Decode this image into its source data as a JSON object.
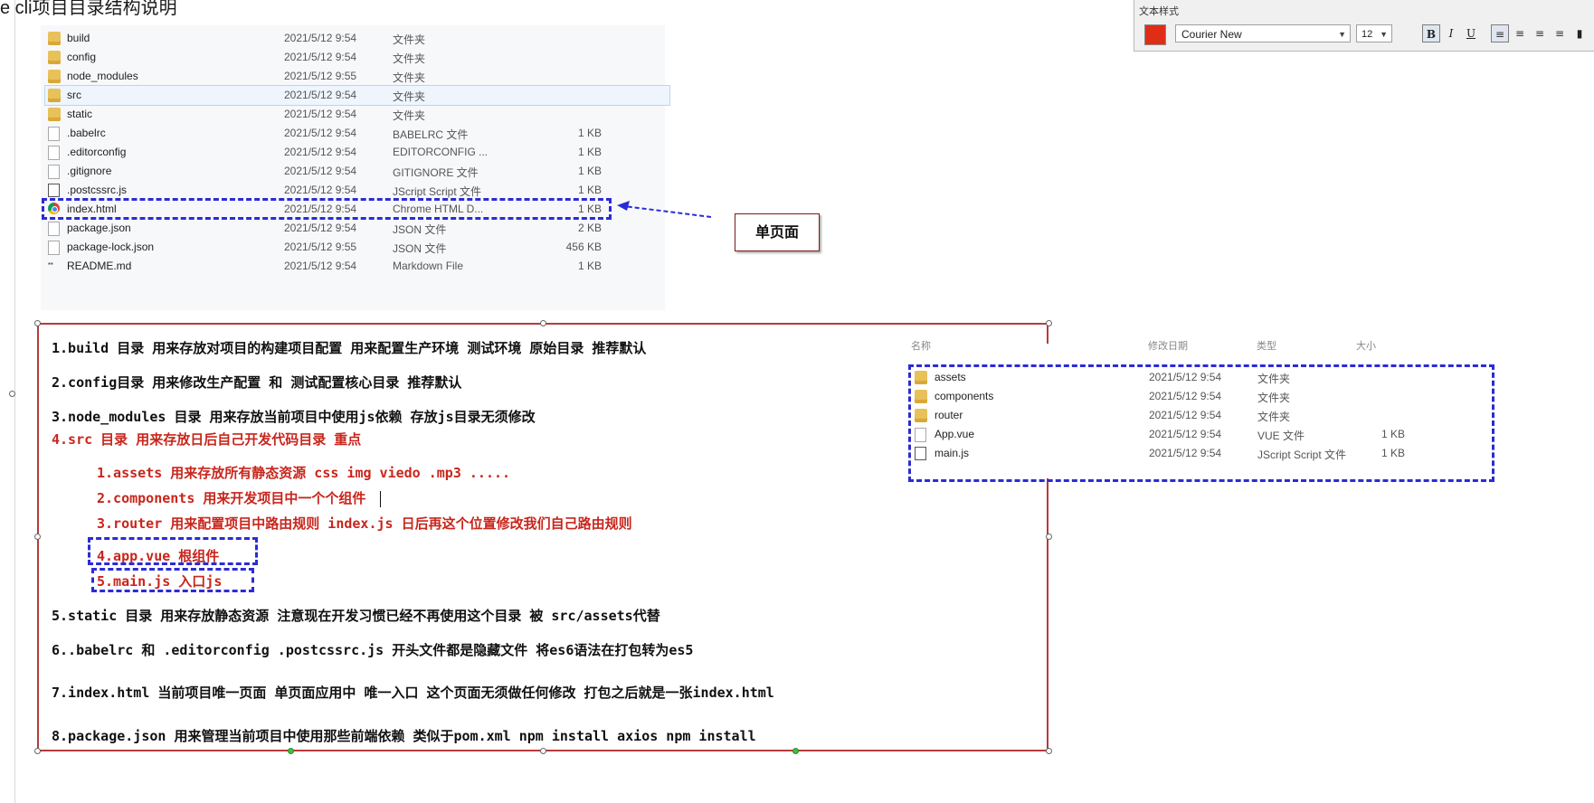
{
  "slide": {
    "title": "e cli项目目录结构说明"
  },
  "explorer_main": {
    "rows": [
      {
        "icon": "folder-icon",
        "name": "build",
        "date": "2021/5/12 9:54",
        "type": "文件夹",
        "size": ""
      },
      {
        "icon": "folder-icon",
        "name": "config",
        "date": "2021/5/12 9:54",
        "type": "文件夹",
        "size": ""
      },
      {
        "icon": "folder-icon",
        "name": "node_modules",
        "date": "2021/5/12 9:55",
        "type": "文件夹",
        "size": ""
      },
      {
        "icon": "folder-icon",
        "name": "src",
        "date": "2021/5/12 9:54",
        "type": "文件夹",
        "size": ""
      },
      {
        "icon": "folder-icon",
        "name": "static",
        "date": "2021/5/12 9:54",
        "type": "文件夹",
        "size": ""
      },
      {
        "icon": "file-icon",
        "name": ".babelrc",
        "date": "2021/5/12 9:54",
        "type": "BABELRC 文件",
        "size": "1 KB"
      },
      {
        "icon": "file-icon",
        "name": ".editorconfig",
        "date": "2021/5/12 9:54",
        "type": "EDITORCONFIG ...",
        "size": "1 KB"
      },
      {
        "icon": "file-icon",
        "name": ".gitignore",
        "date": "2021/5/12 9:54",
        "type": "GITIGNORE 文件",
        "size": "1 KB"
      },
      {
        "icon": "jscript-icon",
        "name": ".postcssrc.js",
        "date": "2021/5/12 9:54",
        "type": "JScript Script 文件",
        "size": "1 KB"
      },
      {
        "icon": "chrome-icon",
        "name": "index.html",
        "date": "2021/5/12 9:54",
        "type": "Chrome HTML D...",
        "size": "1 KB"
      },
      {
        "icon": "file-icon",
        "name": "package.json",
        "date": "2021/5/12 9:54",
        "type": "JSON 文件",
        "size": "2 KB"
      },
      {
        "icon": "file-icon",
        "name": "package-lock.json",
        "date": "2021/5/12 9:55",
        "type": "JSON 文件",
        "size": "456 KB"
      },
      {
        "icon": "markdown-icon",
        "name": "README.md",
        "date": "2021/5/12 9:54",
        "type": "Markdown File",
        "size": "1 KB"
      }
    ]
  },
  "callout": {
    "label": "单页面"
  },
  "notes": {
    "lines": [
      {
        "text": "1.build 目录  用来存放对项目的构建项目配置  用来配置生产环境  测试环境  原始目录  推荐默认",
        "color": "black"
      },
      {
        "text": "2.config目录  用来修改生产配置 和 测试配置核心目录   推荐默认",
        "color": "black"
      },
      {
        "text": "3.node_modules 目录 用来存放当前项目中使用js依赖     存放js目录无须修改",
        "color": "black"
      },
      {
        "text": "4.src   目录  用来存放日后自己开发代码目录   重点",
        "color": "red"
      },
      {
        "text": "1.assets  用来存放所有静态资源 css  img  viedo   .mp3 .....",
        "color": "red"
      },
      {
        "text": "2.components 用来开发项目中一个个组件",
        "color": "red"
      },
      {
        "text": "3.router  用来配置项目中路由规则   index.js 日后再这个位置修改我们自己路由规则",
        "color": "red"
      },
      {
        "text": "4.app.vue  根组件",
        "color": "red"
      },
      {
        "text": "5.main.js  入口js",
        "color": "red"
      },
      {
        "text": "5.static 目录 用来存放静态资源 注意现在开发习惯已经不再使用这个目录 被  src/assets代替",
        "color": "black"
      },
      {
        "text": "6..babelrc 和 .editorconfig .postcssrc.js 开头文件都是隐藏文件 将es6语法在打包转为es5",
        "color": "black"
      },
      {
        "text": "7.index.html 当前项目唯一页面  单页面应用中 唯一入口  这个页面无须做任何修改 打包之后就是一张index.html",
        "color": "black"
      },
      {
        "text": "8.package.json 用来管理当前项目中使用那些前端依赖 类似于pom.xml  npm install axios  npm install",
        "color": "black"
      }
    ]
  },
  "explorer_src": {
    "headers": [
      "名称",
      "修改日期",
      "类型",
      "大小"
    ],
    "rows": [
      {
        "icon": "folder-icon",
        "name": "assets",
        "date": "2021/5/12 9:54",
        "type": "文件夹",
        "size": ""
      },
      {
        "icon": "folder-icon",
        "name": "components",
        "date": "2021/5/12 9:54",
        "type": "文件夹",
        "size": ""
      },
      {
        "icon": "folder-icon",
        "name": "router",
        "date": "2021/5/12 9:54",
        "type": "文件夹",
        "size": ""
      },
      {
        "icon": "file-icon",
        "name": "App.vue",
        "date": "2021/5/12 9:54",
        "type": "VUE 文件",
        "size": "1 KB"
      },
      {
        "icon": "jscript-icon",
        "name": "main.js",
        "date": "2021/5/12 9:54",
        "type": "JScript Script 文件",
        "size": "1 KB"
      }
    ]
  },
  "text_style_toolbar": {
    "title": "文本样式",
    "color": "#e02d16",
    "font": "Courier New",
    "size": "12"
  }
}
